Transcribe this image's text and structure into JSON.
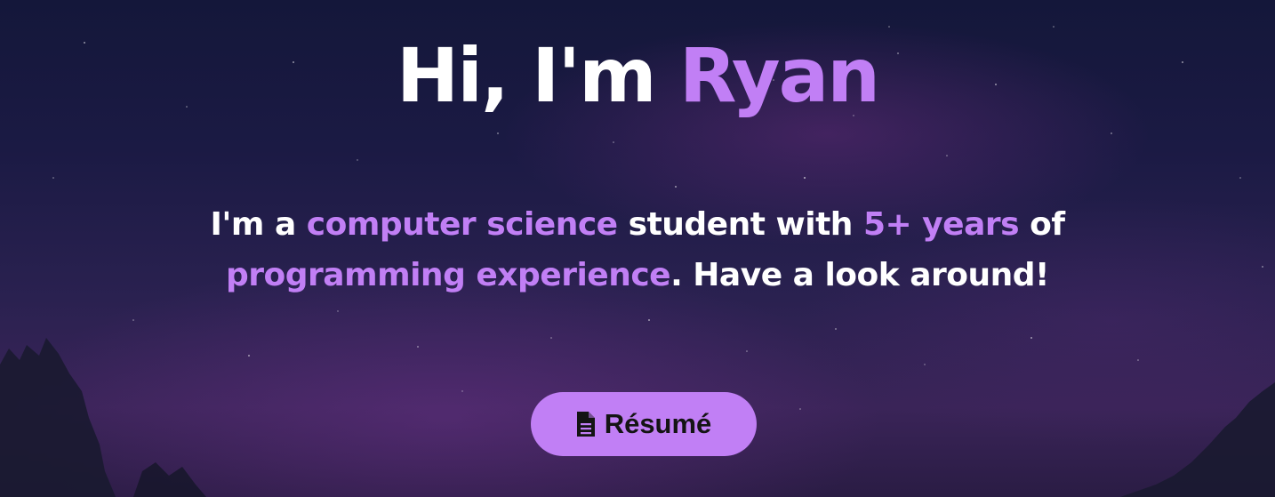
{
  "hero": {
    "title": {
      "prefix": "Hi, I'm ",
      "name": "Ryan"
    },
    "tagline": {
      "part1": "I'm a ",
      "highlight1": "computer science",
      "part2": " student with ",
      "highlight2": "5+ years",
      "part3": " of ",
      "highlight3": "programming experience",
      "part4": ". Have a look around!"
    },
    "resume_button": {
      "label": "Résumé",
      "icon": "document-icon"
    }
  },
  "colors": {
    "accent": "#c17ff5",
    "text": "#ffffff",
    "button_text": "#141414",
    "background_top": "#14173a",
    "background_bottom": "#3a2458"
  }
}
